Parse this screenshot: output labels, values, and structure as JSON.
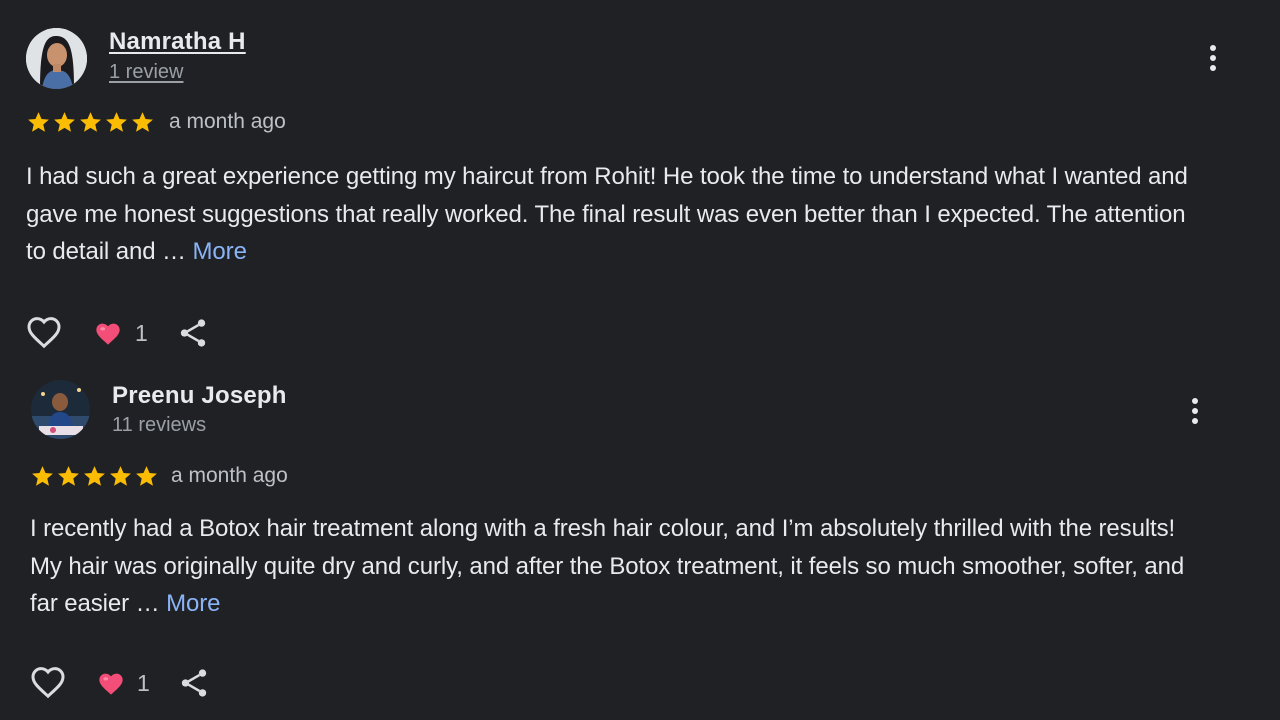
{
  "reviews": [
    {
      "name": "Namratha H",
      "review_count": "1 review",
      "rating": 5,
      "time": "a month ago",
      "text": "I had such a great experience getting my haircut from Rohit! He took the time to understand what I wanted and gave me honest suggestions that really worked. The final result was even better than I expected. The attention to detail and …",
      "more_label": "More",
      "reaction_count": "1"
    },
    {
      "name": "Preenu Joseph",
      "review_count": "11 reviews",
      "rating": 5,
      "time": "a month ago",
      "text": "I recently had a Botox hair treatment along with a fresh hair colour, and I’m absolutely thrilled with the results! My hair was originally quite dry and curly, and after the Botox treatment, it feels so much smoother, softer, and far easier …",
      "more_label": "More",
      "reaction_count": "1"
    }
  ],
  "colors": {
    "background": "#202124",
    "star": "#fbbc04",
    "link": "#8ab4f8",
    "heart": "#f24e78"
  },
  "icons": [
    "star-icon",
    "more-vert-icon",
    "like-outline-icon",
    "heart-reaction-icon",
    "share-icon"
  ]
}
